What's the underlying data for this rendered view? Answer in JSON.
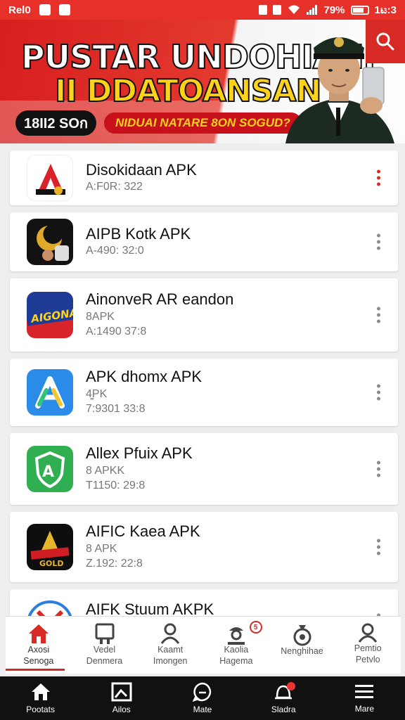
{
  "status_bar": {
    "carrier": "Rel0",
    "battery": "79%",
    "time": "1ಟ:3"
  },
  "banner": {
    "title_line1": "PUSTAR UNDOHIANI",
    "title_line2": "II DDATOANSAN",
    "pill_dark": "18II2 SOก",
    "pill_red": "NIDUAI NATARE 8ON SOGUD?"
  },
  "apps": [
    {
      "name": "Disokidaan APK",
      "lines": [
        "A:F0R: 322"
      ],
      "menu_color": "red"
    },
    {
      "name": "AIPB Kotk APK",
      "lines": [
        "A-490: 32:0"
      ],
      "menu_color": "gray"
    },
    {
      "name": "AinonveR AR eandon",
      "lines": [
        "8APK",
        "A:1490 37:8"
      ],
      "menu_color": "gray"
    },
    {
      "name": "APK dhomx APK",
      "lines": [
        "4̳PK",
        "7:9301 33:8"
      ],
      "menu_color": "gray"
    },
    {
      "name": "Allex Pfuix APK",
      "lines": [
        "8 APKK",
        "T1150: 29:8"
      ],
      "menu_color": "gray"
    },
    {
      "name": "AIFIC Kaea APK",
      "lines": [
        "8 APK",
        "Z.192: 22:8"
      ],
      "menu_color": "gray"
    },
    {
      "name": "AIFK Stuum AKPK",
      "lines": [],
      "menu_color": "gray"
    }
  ],
  "categories": [
    {
      "label": "Axosi\nSenoga",
      "icon": "home-icon"
    },
    {
      "label": "Vedel\nDenmera",
      "icon": "tablet-icon"
    },
    {
      "label": "Kaamt\nImongen",
      "icon": "person-icon"
    },
    {
      "label": "Kaolia\nHagema",
      "icon": "chef-icon",
      "badge": "5"
    },
    {
      "label": "Nenghihae",
      "icon": "money-bag-icon"
    },
    {
      "label": "Pemtio\nPetvlo",
      "icon": "user-icon"
    }
  ],
  "nav": [
    {
      "label": "Pootats",
      "icon": "home-icon"
    },
    {
      "label": "Ailos",
      "icon": "image-icon"
    },
    {
      "label": "Mate",
      "icon": "chat-icon"
    },
    {
      "label": "Sladra",
      "icon": "bell-icon"
    },
    {
      "label": "Mare",
      "icon": "hamburger-icon"
    }
  ],
  "colors": {
    "accent": "#d72a24",
    "banner_yellow": "#ffd21a",
    "nav_bg": "#111111"
  }
}
